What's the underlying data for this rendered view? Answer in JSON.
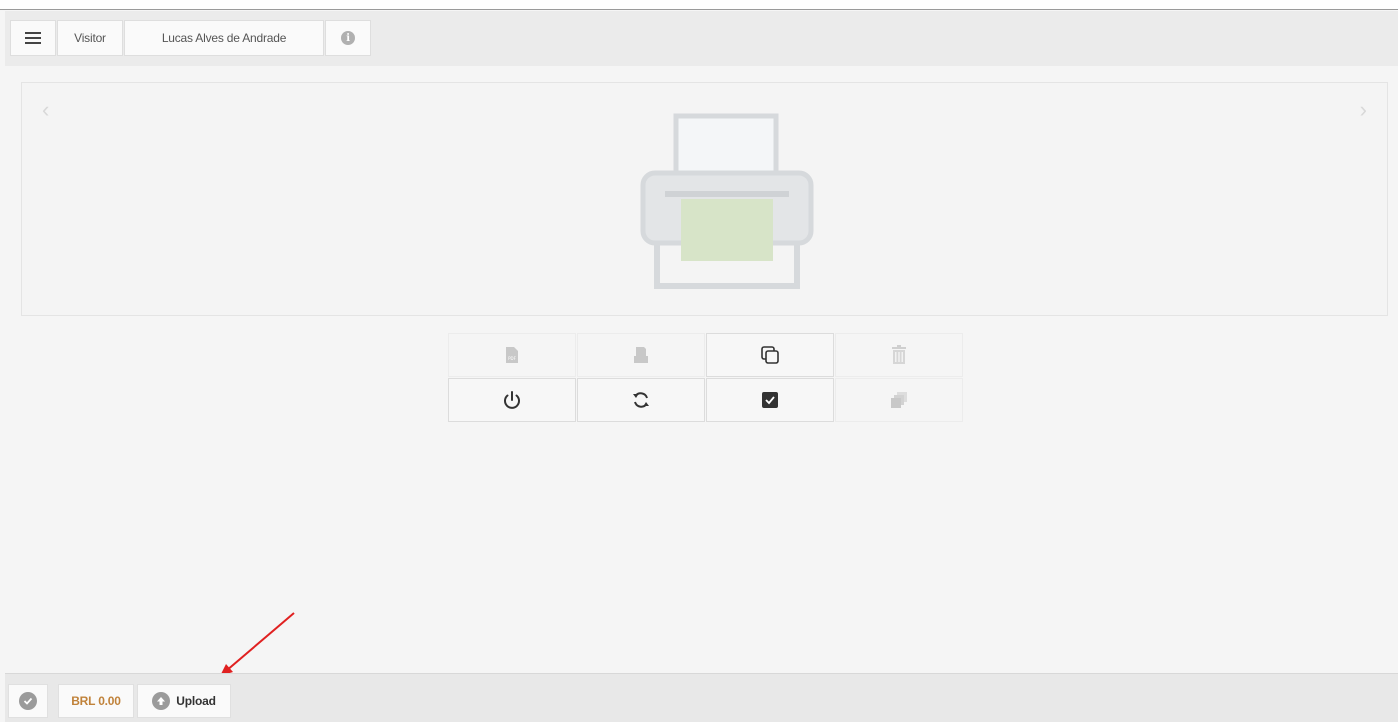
{
  "header": {
    "visitor_label": "Visitor",
    "user_name": "Lucas Alves de Andrade",
    "menu_icon": "hamburger-menu-icon",
    "info_icon": "info-icon"
  },
  "preview": {
    "prev_glyph": "‹",
    "next_glyph": "›",
    "illustration": "printer-icon"
  },
  "actions": [
    {
      "icon": "pdf-file-icon",
      "enabled": false
    },
    {
      "icon": "print-icon",
      "enabled": false
    },
    {
      "icon": "copy-icon",
      "enabled": true
    },
    {
      "icon": "trash-icon",
      "enabled": false
    },
    {
      "icon": "power-icon",
      "enabled": true
    },
    {
      "icon": "refresh-icon",
      "enabled": true
    },
    {
      "icon": "checkbox-icon",
      "enabled": true
    },
    {
      "icon": "stack-icon",
      "enabled": false
    }
  ],
  "footer": {
    "status_icon": "check-circle-icon",
    "balance": "BRL 0.00",
    "upload_label": "Upload",
    "upload_icon": "upload-arrow-icon"
  },
  "colors": {
    "balance_text": "#c0823a",
    "annotation_arrow": "#e02020",
    "printer_paper": "#d7e4c8"
  }
}
